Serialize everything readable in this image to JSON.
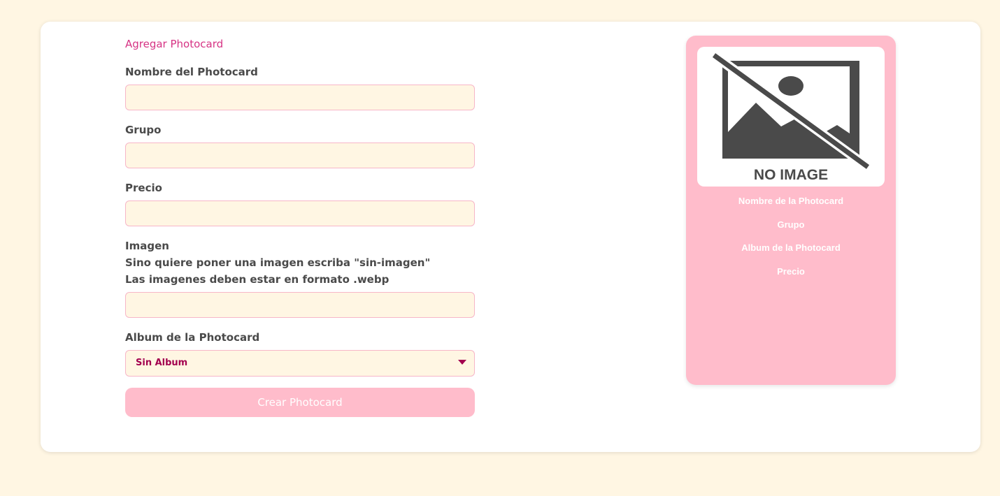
{
  "form": {
    "title": "Agregar Photocard",
    "name_label": "Nombre del Photocard",
    "name_value": "",
    "group_label": "Grupo",
    "group_value": "",
    "price_label": "Precio",
    "price_value": "",
    "image_label_lines": [
      "Imagen",
      "Sino quiere poner una imagen escriba \"sin-imagen\"",
      "Las imagenes deben estar en formato .webp"
    ],
    "image_value": "",
    "album_label": "Album de la Photocard",
    "album_selected": "Sin Album",
    "submit_label": "Crear Photocard"
  },
  "preview": {
    "image_placeholder_text": "NO IMAGE",
    "name": "Nombre de la Photocard",
    "group": "Grupo",
    "album": "Album de la Photocard",
    "price": "Precio"
  },
  "colors": {
    "page_background": "#fff6e3",
    "accent_pink": "#ffbccb",
    "title_pink": "#d63384",
    "select_text": "#a3004f",
    "input_border": "#f7b6c8"
  },
  "icons": {
    "no_image": "no-image-icon",
    "dropdown": "caret-down-icon"
  }
}
